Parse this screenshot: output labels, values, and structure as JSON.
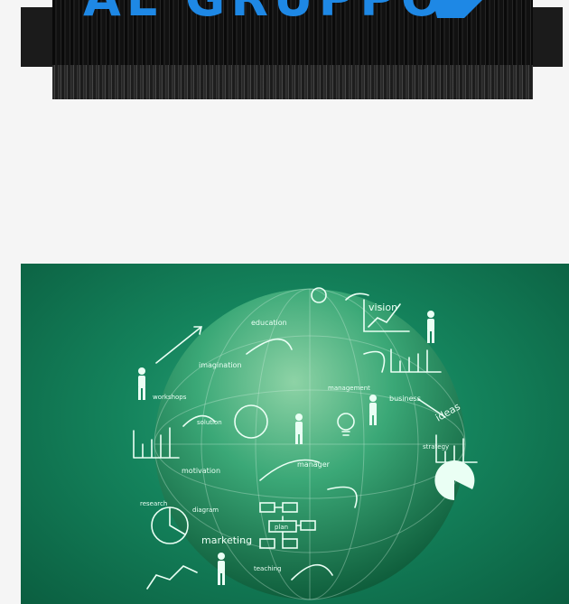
{
  "banner": {
    "logo_text": "AL GRUPPO",
    "logo_icon": "blue-arrow-logo-icon",
    "colors": {
      "logo": "#1e88e5",
      "background": "#0f0f0f"
    }
  },
  "image": {
    "labels": {
      "vision": "vision",
      "education": "education",
      "imagination": "imagination",
      "workshops": "workshops",
      "solution": "solution",
      "management": "management",
      "business": "business",
      "ideas": "ideas",
      "strategy": "strategy",
      "motivation": "motivation",
      "manager": "manager",
      "research": "research",
      "diagram": "diagram",
      "marketing": "marketing",
      "teaching": "teaching",
      "plan": "plan"
    },
    "colors": {
      "background": "#14835c",
      "globe": "#2e9d6e",
      "lines": "#eafff4"
    }
  }
}
